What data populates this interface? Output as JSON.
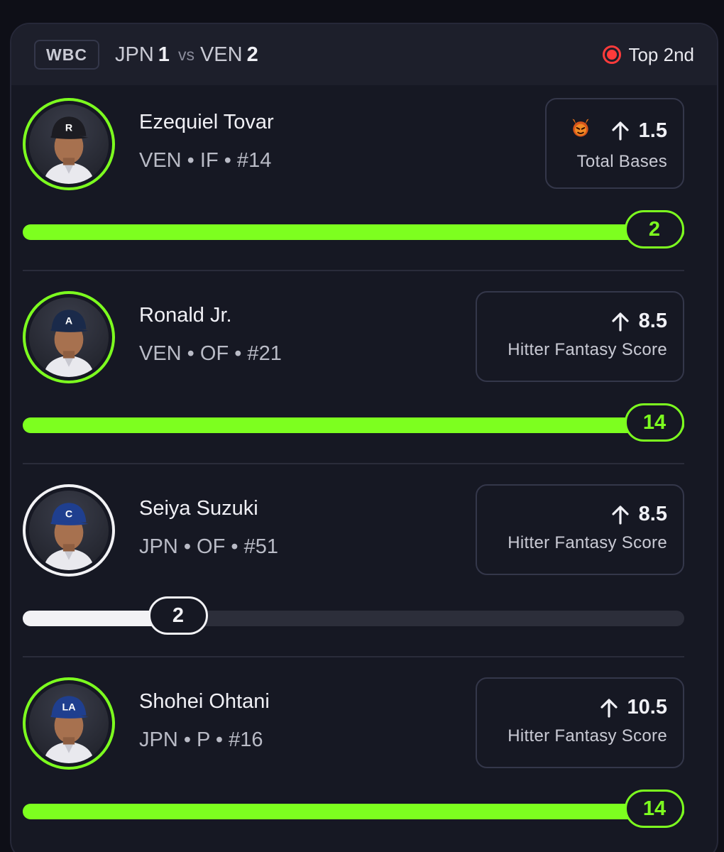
{
  "header": {
    "league": "WBC",
    "team1": "JPN",
    "score1": "1",
    "vs": "vs",
    "team2": "VEN",
    "score2": "2",
    "status": "Top 2nd",
    "status_color": "#ff3b3b"
  },
  "colors": {
    "hit": "#7dff1f",
    "miss": "#f2f2f5",
    "track": "#2c2e3a"
  },
  "players": [
    {
      "name": "Ezequiel Tovar",
      "meta": "VEN • IF • #14",
      "direction_icon": "arrow-up-icon",
      "line": "1.5",
      "stat": "Total Bases",
      "badge_icon": "demon-icon",
      "current": "2",
      "progress": 1.0,
      "status": "hit",
      "cap_letter": "R"
    },
    {
      "name": "Ronald Jr.",
      "meta": "VEN • OF • #21",
      "direction_icon": "arrow-up-icon",
      "line": "8.5",
      "stat": "Hitter Fantasy Score",
      "current": "14",
      "progress": 1.0,
      "status": "hit",
      "cap_letter": "A"
    },
    {
      "name": "Seiya Suzuki",
      "meta": "JPN • OF • #51",
      "direction_icon": "arrow-up-icon",
      "line": "8.5",
      "stat": "Hitter Fantasy Score",
      "current": "2",
      "progress": 0.235,
      "status": "miss",
      "cap_letter": "C"
    },
    {
      "name": "Shohei Ohtani",
      "meta": "JPN • P • #16",
      "direction_icon": "arrow-up-icon",
      "line": "10.5",
      "stat": "Hitter Fantasy Score",
      "current": "14",
      "progress": 1.0,
      "status": "hit",
      "cap_letter": "LA"
    }
  ]
}
